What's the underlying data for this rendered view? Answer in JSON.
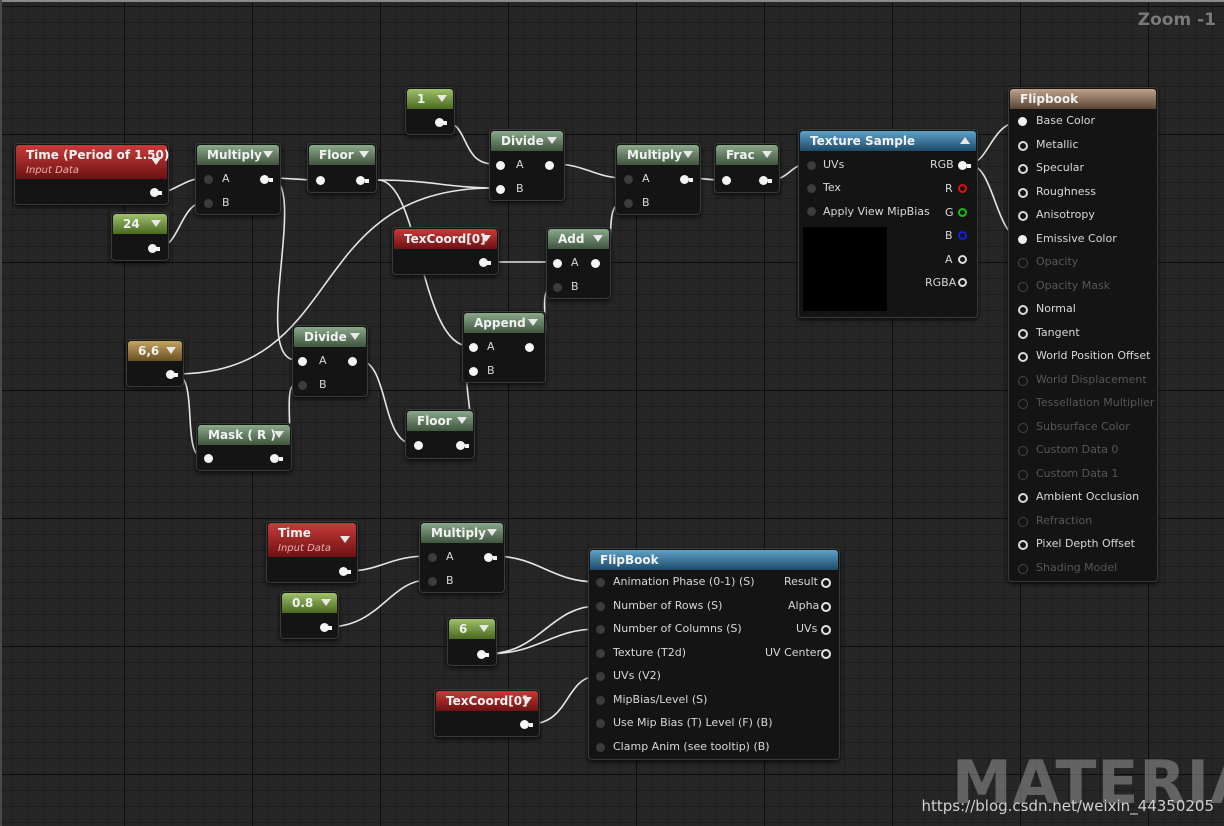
{
  "viewport": {
    "zoom_label": "Zoom -1"
  },
  "watermark": {
    "brand": "MATERIAL",
    "url": "https://blog.csdn.net/weixin_44350205"
  },
  "nodes": {
    "time_period": {
      "title": "Time (Period of 1.50)",
      "subtitle": "Input Data"
    },
    "const_24": {
      "title": "24"
    },
    "multiply_1": {
      "title": "Multiply",
      "pin_a": "A",
      "pin_b": "B"
    },
    "floor_1": {
      "title": "Floor"
    },
    "const_1": {
      "title": "1"
    },
    "divide_1": {
      "title": "Divide",
      "pin_a": "A",
      "pin_b": "B"
    },
    "multiply_2": {
      "title": "Multiply",
      "pin_a": "A",
      "pin_b": "B"
    },
    "frac": {
      "title": "Frac"
    },
    "texcoord_1": {
      "title": "TexCoord[0]"
    },
    "add": {
      "title": "Add",
      "pin_a": "A",
      "pin_b": "B"
    },
    "const_66": {
      "title": "6,6"
    },
    "divide_2": {
      "title": "Divide",
      "pin_a": "A",
      "pin_b": "B"
    },
    "append": {
      "title": "Append",
      "pin_a": "A",
      "pin_b": "B"
    },
    "mask_r": {
      "title": "Mask ( R )"
    },
    "floor_2": {
      "title": "Floor"
    },
    "texture_sample": {
      "title": "Texture Sample",
      "inputs": [
        "UVs",
        "Tex",
        "Apply View MipBias"
      ],
      "outputs": [
        "RGB",
        "R",
        "G",
        "B",
        "A",
        "RGBA"
      ]
    },
    "time": {
      "title": "Time",
      "subtitle": "Input Data"
    },
    "multiply_3": {
      "title": "Multiply",
      "pin_a": "A",
      "pin_b": "B"
    },
    "const_08": {
      "title": "0.8"
    },
    "const_6": {
      "title": "6"
    },
    "texcoord_2": {
      "title": "TexCoord[0]"
    },
    "flipbook_fn": {
      "title": "FlipBook",
      "inputs": [
        "Animation  Phase (0-1) (S)",
        "Number of Rows (S)",
        "Number of Columns (S)",
        "Texture (T2d)",
        "UVs (V2)",
        "MipBias/Level (S)",
        "Use Mip Bias (T) Level (F) (B)",
        "Clamp Anim (see tooltip) (B)"
      ],
      "outputs": [
        "Result",
        "Alpha",
        "UVs",
        "UV Center"
      ]
    },
    "result": {
      "title": "Flipbook",
      "pins": [
        {
          "label": "Base Color",
          "state": "connected"
        },
        {
          "label": "Metallic",
          "state": "active"
        },
        {
          "label": "Specular",
          "state": "active"
        },
        {
          "label": "Roughness",
          "state": "active"
        },
        {
          "label": "Anisotropy",
          "state": "active"
        },
        {
          "label": "Emissive Color",
          "state": "connected"
        },
        {
          "label": "Opacity",
          "state": "disabled"
        },
        {
          "label": "Opacity Mask",
          "state": "disabled"
        },
        {
          "label": "Normal",
          "state": "active"
        },
        {
          "label": "Tangent",
          "state": "active"
        },
        {
          "label": "World Position Offset",
          "state": "active"
        },
        {
          "label": "World Displacement",
          "state": "disabled"
        },
        {
          "label": "Tessellation Multiplier",
          "state": "disabled"
        },
        {
          "label": "Subsurface Color",
          "state": "disabled"
        },
        {
          "label": "Custom Data 0",
          "state": "disabled"
        },
        {
          "label": "Custom Data 1",
          "state": "disabled"
        },
        {
          "label": "Ambient Occlusion",
          "state": "active"
        },
        {
          "label": "Refraction",
          "state": "disabled"
        },
        {
          "label": "Pixel Depth Offset",
          "state": "active"
        },
        {
          "label": "Shading Model",
          "state": "disabled"
        }
      ]
    }
  },
  "colors": {
    "constant_scalar": "#48691f",
    "constant_vector": "#6a5022",
    "input_data": "#6d1212",
    "math": "#3f563f",
    "texture": "#1d4a6a",
    "result": "#5a4434",
    "wire": "#e6e6e6"
  }
}
